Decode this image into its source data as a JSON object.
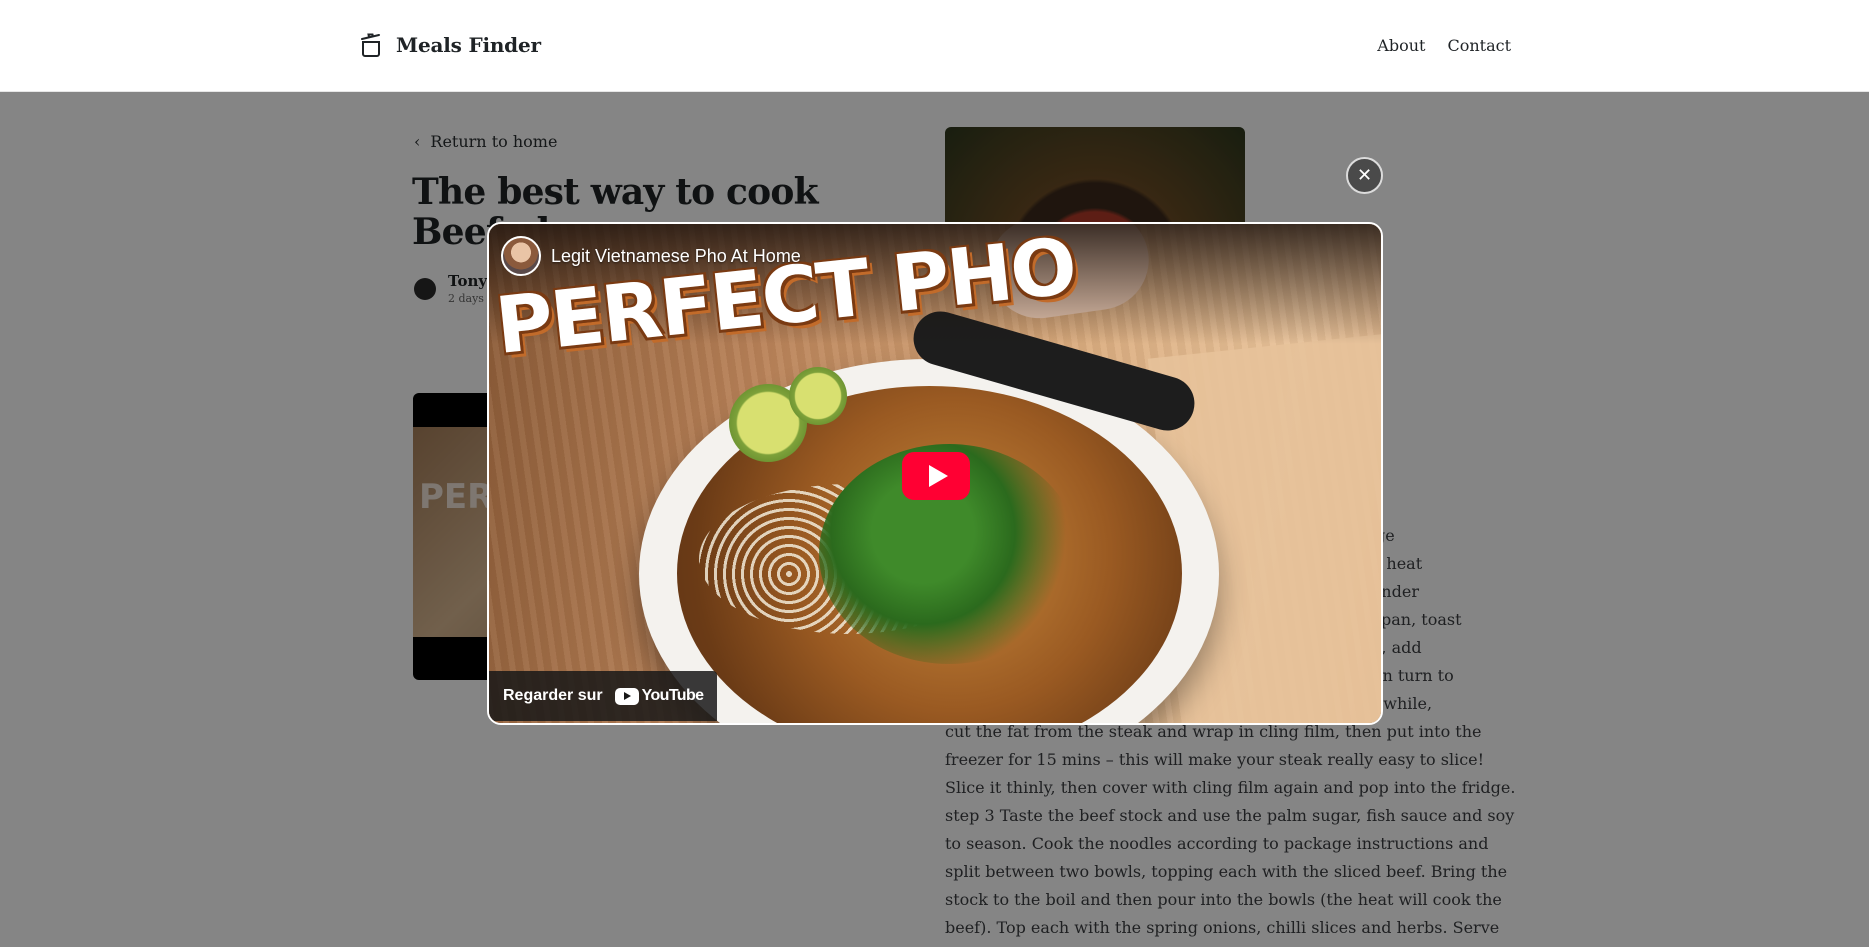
{
  "header": {
    "brand": "Meals Finder",
    "nav": {
      "about": "About",
      "contact": "Contact"
    }
  },
  "article": {
    "back_label": "Return to home",
    "title": "The best way to cook Beef pho",
    "author_name": "Tony",
    "author_time": "2 days",
    "thumb_text": "PER",
    "body_fragments": [
      "ge",
      "h heat",
      "under",
      "pan, toast",
      "t, add",
      "en turn to",
      "nwhile,",
      "cut the fat from the steak and wrap in cling film, then put into the",
      "freezer for 15 mins – this will make your steak really easy to slice!",
      "Slice it thinly, then cover with cling film again and pop into the fridge.",
      "step 3 Taste the beef stock and use the palm sugar, fish sauce and soy",
      "to season. Cook the noodles according to package instructions and",
      "split between two bowls, topping each with the sliced beef. Bring the",
      "stock to the boil and then pour into the bowls (the heat will cook the",
      "beef). Top each with the spring onions, chilli slices and herbs. Serve"
    ]
  },
  "modal": {
    "close_label": "✕",
    "video_title": "Legit Vietnamese Pho At Home",
    "overlay_text": "PERFECT PHO",
    "watch_on_label": "Regarder sur",
    "youtube_label": "YouTube"
  },
  "colors": {
    "overlay": "#000000",
    "play_button": "#ff0033",
    "brand_text": "#1f2326"
  }
}
